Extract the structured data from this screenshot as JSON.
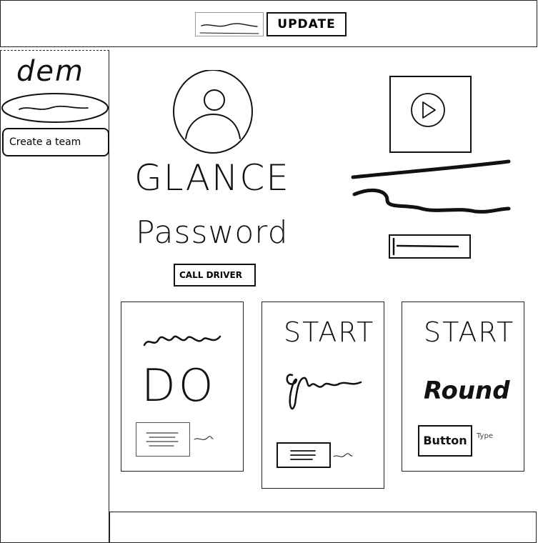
{
  "header": {
    "update_label": "UPDATE"
  },
  "sidebar": {
    "title": "dem",
    "create_team_label": "Create a team"
  },
  "profile": {
    "name": "GLANCE",
    "password_label": "Password",
    "call_driver_label": "CALL DRIVER"
  },
  "cards": [
    {
      "heading": "",
      "big_text": "DO",
      "button_caption": ""
    },
    {
      "heading": "START",
      "big_text": "",
      "button_caption": ""
    },
    {
      "heading": "START",
      "big_text": "Round",
      "button_label": "Button",
      "button_caption": "Type"
    }
  ],
  "icons": {
    "avatar": "user-avatar-icon",
    "play": "play-icon"
  }
}
